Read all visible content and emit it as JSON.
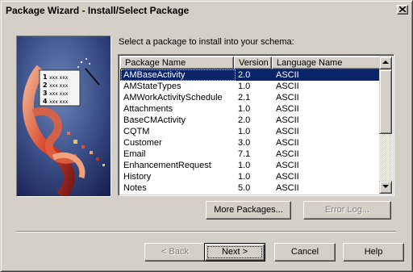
{
  "window": {
    "title": "Package Wizard - Install/Select Package"
  },
  "instruction": "Select a package to install into your schema:",
  "table": {
    "columns": [
      "Package Name",
      "Version",
      "Language Name"
    ],
    "rows": [
      {
        "name": "AMBaseActivity",
        "version": "2.0",
        "language": "ASCII",
        "selected": true
      },
      {
        "name": "AMStateTypes",
        "version": "1.0",
        "language": "ASCII"
      },
      {
        "name": "AMWorkActivitySchedule",
        "version": "2.1",
        "language": "ASCII"
      },
      {
        "name": "Attachments",
        "version": "1.0",
        "language": "ASCII"
      },
      {
        "name": "BaseCMActivity",
        "version": "2.0",
        "language": "ASCII"
      },
      {
        "name": "CQTM",
        "version": "1.0",
        "language": "ASCII"
      },
      {
        "name": "Customer",
        "version": "3.0",
        "language": "ASCII"
      },
      {
        "name": "Email",
        "version": "7.1",
        "language": "ASCII"
      },
      {
        "name": "EnhancementRequest",
        "version": "1.0",
        "language": "ASCII"
      },
      {
        "name": "History",
        "version": "1.0",
        "language": "ASCII"
      },
      {
        "name": "Notes",
        "version": "5.0",
        "language": "ASCII"
      }
    ]
  },
  "graphic": {
    "list_lines": [
      "1",
      "2",
      "3",
      "4"
    ],
    "list_text": "xxx xxx"
  },
  "buttons": {
    "more_packages": "More Packages...",
    "error_log": "Error Log...",
    "back": "< Back",
    "next": "Next >",
    "cancel": "Cancel",
    "help": "Help"
  },
  "colors": {
    "dialog_face": "#d4d0c8",
    "selection": "#0a246a",
    "graphic_bg": "#2c3a6e"
  }
}
